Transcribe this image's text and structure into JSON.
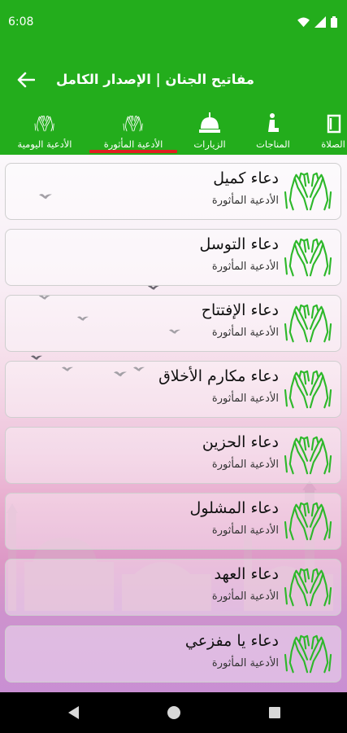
{
  "status_bar": {
    "time": "6:08"
  },
  "app_bar": {
    "title": "مفاتيح الجنان | الإصدار الكامل"
  },
  "tabs": [
    {
      "label": "الصلاة",
      "icon": "book-icon"
    },
    {
      "label": "المناجات",
      "icon": "praying-person-icon"
    },
    {
      "label": "الزيارات",
      "icon": "dome-icon"
    },
    {
      "label": "الأدعية المأثورة",
      "icon": "praying-hands-icon",
      "selected": true
    },
    {
      "label": "الأدعية اليومية",
      "icon": "praying-hands-icon"
    }
  ],
  "prayers": [
    {
      "title": "دعاء كميل",
      "category": "الأدعية المأثورة"
    },
    {
      "title": "دعاء التوسل",
      "category": "الأدعية المأثورة"
    },
    {
      "title": "دعاء الإفتتاح",
      "category": "الأدعية المأثورة"
    },
    {
      "title": "دعاء مكارم الأخلاق",
      "category": "الأدعية المأثورة"
    },
    {
      "title": "دعاء الحزين",
      "category": "الأدعية المأثورة"
    },
    {
      "title": "دعاء المشلول",
      "category": "الأدعية المأثورة"
    },
    {
      "title": "دعاء العهد",
      "category": "الأدعية المأثورة"
    },
    {
      "title": "دعاء يا مفزعي",
      "category": "الأدعية المأثورة"
    }
  ],
  "colors": {
    "primary": "#23ad1c",
    "indicator": "#e02020",
    "hands_icon": "#2db82a"
  }
}
